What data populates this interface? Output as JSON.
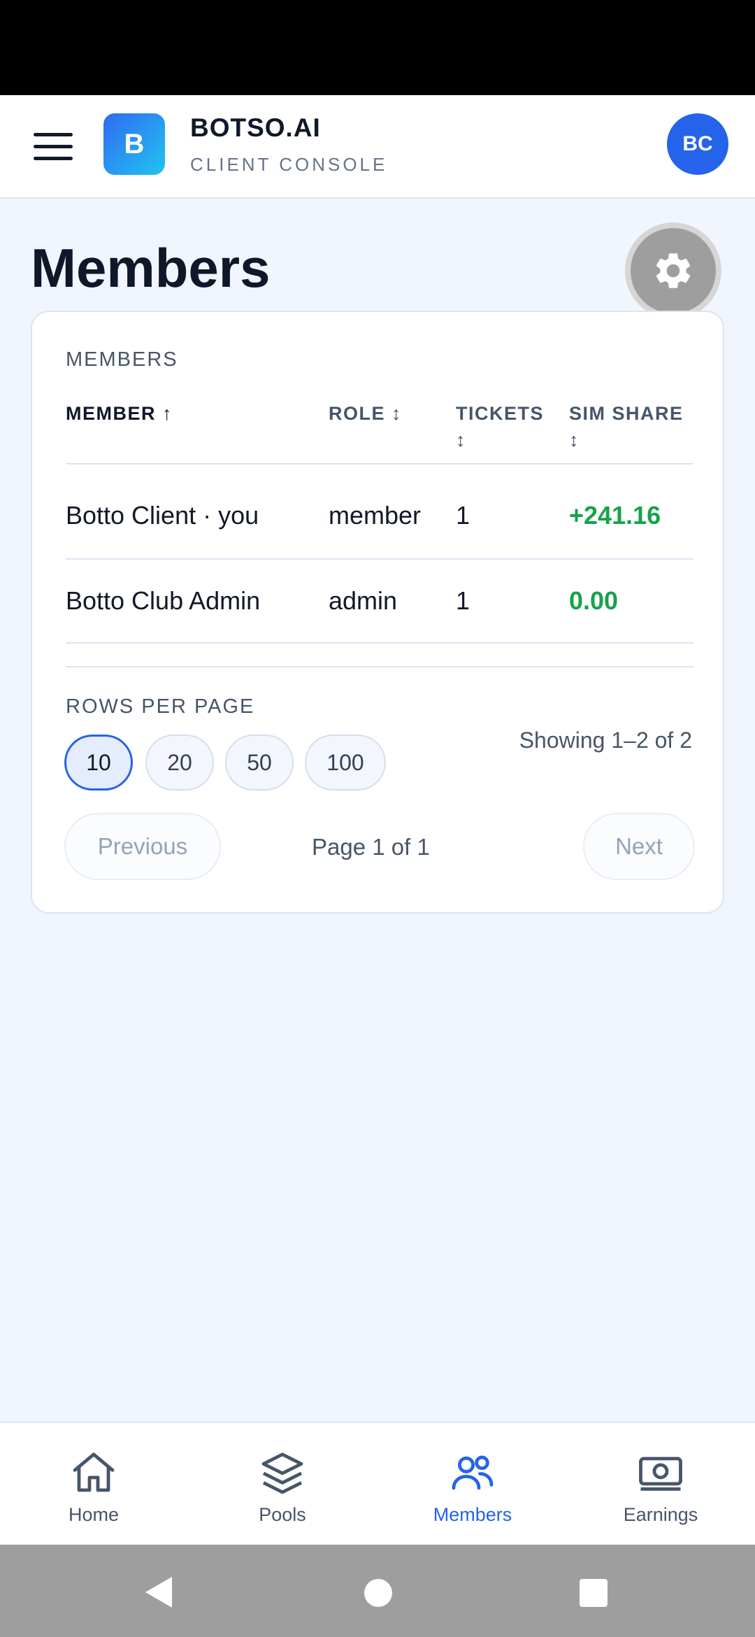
{
  "header": {
    "logo_letter": "B",
    "brand_name": "BOTSO.AI",
    "brand_sub": "CLIENT CONSOLE",
    "avatar_initials": "BC"
  },
  "page": {
    "title": "Members"
  },
  "card": {
    "label": "MEMBERS",
    "columns": {
      "member": "MEMBER",
      "member_sort": "↑",
      "role": "ROLE",
      "role_sort": "↕",
      "tickets": "TICKETS",
      "tickets_sort": "↕",
      "share": "SIM SHARE",
      "share_sort": "↕"
    },
    "rows": [
      {
        "member": "Botto Client · you",
        "role": "member",
        "tickets": "1",
        "share": "+241.16"
      },
      {
        "member": "Botto Club Admin",
        "role": "admin",
        "tickets": "1",
        "share": "0.00"
      }
    ],
    "rows_per_page_label": "ROWS PER PAGE",
    "page_sizes": [
      "10",
      "20",
      "50",
      "100"
    ],
    "selected_page_size": "10",
    "showing": "Showing 1–2 of 2",
    "previous": "Previous",
    "page_info": "Page 1 of 1",
    "next": "Next"
  },
  "bottom_nav": {
    "items": [
      {
        "label": "Home",
        "icon": "home-icon"
      },
      {
        "label": "Pools",
        "icon": "layers-icon"
      },
      {
        "label": "Members",
        "icon": "users-icon",
        "active": true
      },
      {
        "label": "Earnings",
        "icon": "banknote-icon"
      }
    ]
  },
  "colors": {
    "accent": "#2563eb",
    "positive": "#16a34a",
    "background": "#f1f5fd"
  }
}
